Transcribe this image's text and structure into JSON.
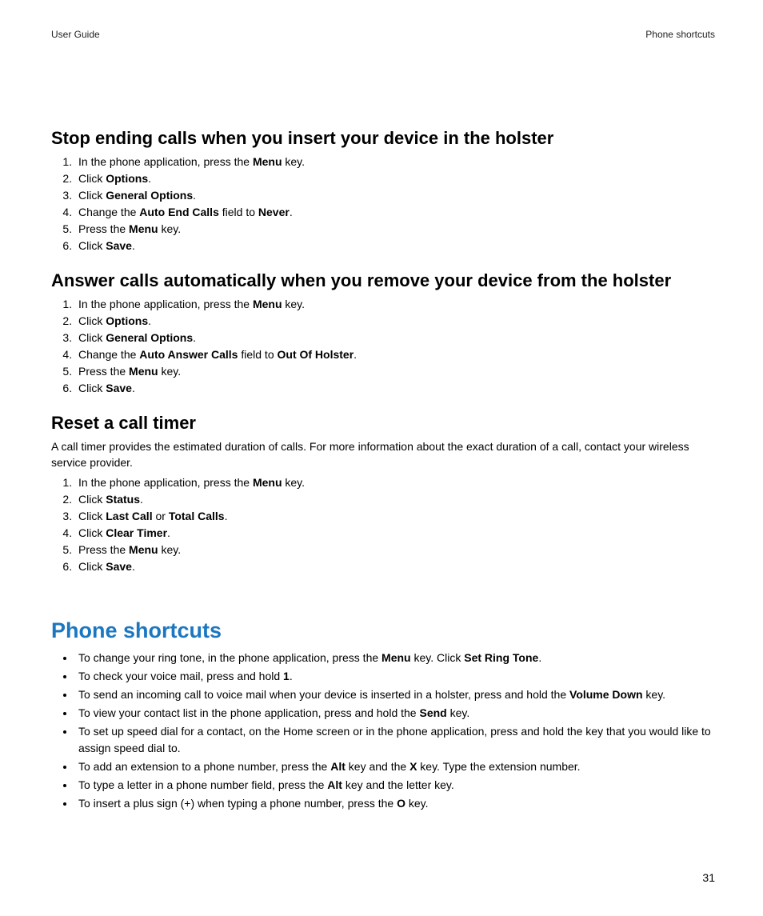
{
  "header": {
    "left": "User Guide",
    "right": "Phone shortcuts"
  },
  "pageNumber": "31",
  "s1": {
    "title": "Stop ending calls when you insert your device in the holster",
    "steps": {
      "i1a": "In the phone application, press the ",
      "i1b": "Menu",
      "i1c": " key.",
      "i2a": "Click ",
      "i2b": "Options",
      "i2c": ".",
      "i3a": "Click ",
      "i3b": "General Options",
      "i3c": ".",
      "i4a": "Change the ",
      "i4b": "Auto End Calls",
      "i4c": " field to ",
      "i4d": "Never",
      "i4e": ".",
      "i5a": "Press the ",
      "i5b": "Menu",
      "i5c": " key.",
      "i6a": "Click ",
      "i6b": "Save",
      "i6c": "."
    }
  },
  "s2": {
    "title": "Answer calls automatically when you remove your device from the holster",
    "steps": {
      "i1a": "In the phone application, press the ",
      "i1b": "Menu",
      "i1c": " key.",
      "i2a": "Click ",
      "i2b": "Options",
      "i2c": ".",
      "i3a": "Click ",
      "i3b": "General Options",
      "i3c": ".",
      "i4a": "Change the ",
      "i4b": "Auto Answer Calls",
      "i4c": " field to ",
      "i4d": "Out Of Holster",
      "i4e": ".",
      "i5a": "Press the ",
      "i5b": "Menu",
      "i5c": " key.",
      "i6a": "Click ",
      "i6b": "Save",
      "i6c": "."
    }
  },
  "s3": {
    "title": "Reset a call timer",
    "intro": "A call timer provides the estimated duration of calls. For more information about the exact duration of a call, contact your wireless service provider.",
    "steps": {
      "i1a": "In the phone application, press the ",
      "i1b": "Menu",
      "i1c": " key.",
      "i2a": "Click ",
      "i2b": "Status",
      "i2c": ".",
      "i3a": "Click ",
      "i3b": "Last Call",
      "i3c": " or ",
      "i3d": "Total Calls",
      "i3e": ".",
      "i4a": "Click ",
      "i4b": "Clear Timer",
      "i4c": ".",
      "i5a": "Press the ",
      "i5b": "Menu",
      "i5c": " key.",
      "i6a": "Click ",
      "i6b": "Save",
      "i6c": "."
    }
  },
  "shortcuts": {
    "title": "Phone shortcuts",
    "items": {
      "b1a": "To change your ring tone, in the phone application, press the ",
      "b1b": "Menu",
      "b1c": " key. Click ",
      "b1d": "Set Ring Tone",
      "b1e": ".",
      "b2a": "To check your voice mail, press and hold ",
      "b2b": "1",
      "b2c": ".",
      "b3a": "To send an incoming call to voice mail when your device is inserted in a holster, press and hold the ",
      "b3b": "Volume Down",
      "b3c": " key.",
      "b4a": "To view your contact list in the phone application, press and hold the ",
      "b4b": "Send",
      "b4c": " key.",
      "b5a": "To set up speed dial for a contact, on the Home screen or in the phone application, press and hold the key that you would like to assign speed dial to.",
      "b6a": "To add an extension to a phone number, press the ",
      "b6b": "Alt",
      "b6c": " key and the ",
      "b6d": "X",
      "b6e": " key. Type the extension number.",
      "b7a": "To type a letter in a phone number field, press the ",
      "b7b": "Alt",
      "b7c": " key and the letter key.",
      "b8a": "To insert a plus sign (+) when typing a phone number, press the ",
      "b8b": "O",
      "b8c": " key."
    }
  }
}
